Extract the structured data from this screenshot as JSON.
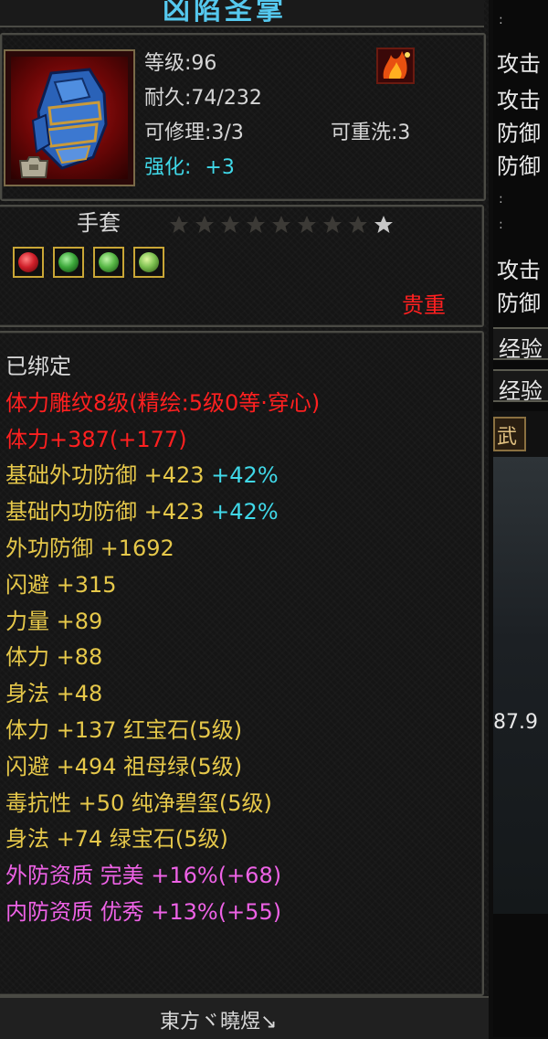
{
  "item": {
    "name": "凶陷圣掌",
    "level": "等级:96",
    "durability": "耐久:74/232",
    "repairable": "可修理:3/3",
    "rewash": "可重洗:3",
    "enhance_label": "强化:",
    "enhance_value": "+3",
    "type": "手套",
    "rarity": "贵重",
    "star_rating": "8/9",
    "icon": "blue-gauntlet-icon",
    "bag_icon": "bag-icon",
    "flame_icon": "flame-rune-icon",
    "gems": [
      {
        "icon": "red-gem-icon",
        "color": "#d0202a"
      },
      {
        "icon": "green-gem-icon",
        "color": "#3ca83a"
      },
      {
        "icon": "green-gem-icon",
        "color": "#58b846"
      },
      {
        "icon": "jade-gem-icon",
        "color": "#7cc050"
      }
    ]
  },
  "stats": [
    {
      "text": "已绑定",
      "color": "#d9d9d9"
    },
    {
      "text": "体力雕纹8级(精绘:5级0等·穿心)",
      "color": "#ff2020"
    },
    {
      "text": "体力+387(+177)",
      "color": "#ff2020"
    },
    {
      "text": "基础外功防御 +423",
      "extra": " +42%",
      "color": "#e6c84a",
      "extra_color": "#40d8e8"
    },
    {
      "text": "基础内功防御 +423",
      "extra": " +42%",
      "color": "#e6c84a",
      "extra_color": "#40d8e8"
    },
    {
      "text": "外功防御 +1692",
      "color": "#e6c84a"
    },
    {
      "text": "闪避 +315",
      "color": "#e6c84a"
    },
    {
      "text": "力量 +89",
      "color": "#e6c84a"
    },
    {
      "text": "体力 +88",
      "color": "#e6c84a"
    },
    {
      "text": "身法 +48",
      "color": "#e6c84a"
    },
    {
      "text": "体力 +137 红宝石(5级)",
      "color": "#e6c84a"
    },
    {
      "text": "闪避 +494 祖母绿(5级)",
      "color": "#e6c84a"
    },
    {
      "text": "毒抗性 +50 纯净碧玺(5级)",
      "color": "#e6c84a"
    },
    {
      "text": "身法 +74 绿宝石(5级)",
      "color": "#e6c84a"
    },
    {
      "text": "外防资质  完美 +16%(+68)",
      "color": "#ee62e6"
    },
    {
      "text": "内防资质  优秀 +13%(+55)",
      "color": "#ee62e6"
    }
  ],
  "footer": {
    "text": "東方ヾ曉煜↘"
  },
  "side": {
    "items": [
      "攻击",
      "攻击",
      "防御",
      "防御",
      "攻击",
      "防御"
    ],
    "exp1": "经验",
    "exp2": "经验",
    "tab": "武",
    "value": "87.9"
  },
  "colors": {
    "title": "#55c8ee",
    "enhance": "#40d8e8",
    "rarity": "#ff2020",
    "star_lit": "#c8c8c8",
    "star_dim": "#3c3a36"
  }
}
